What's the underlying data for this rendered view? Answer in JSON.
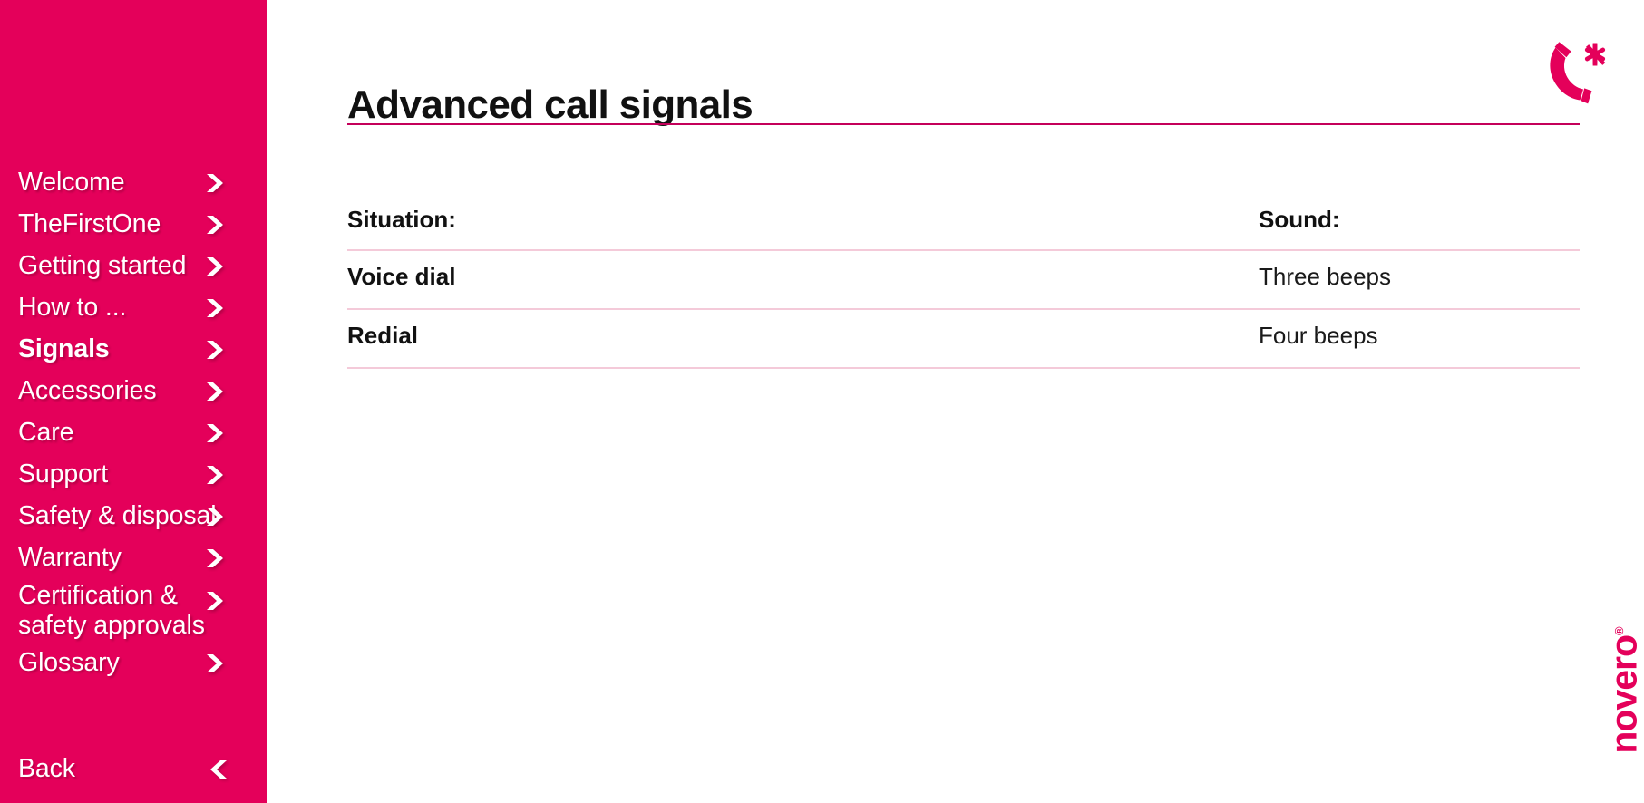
{
  "colors": {
    "brand_pink": "#e4005a",
    "rule_pink": "#c4005a",
    "table_rule_pink": "#f4cad9",
    "sidebar_text": "#ffffff",
    "body_text": "#1a1a1a"
  },
  "sidebar": {
    "items": [
      {
        "label": "Welcome",
        "icon": "chevron-right-icon",
        "active": false
      },
      {
        "label": "TheFirstOne",
        "icon": "chevron-right-icon",
        "active": false
      },
      {
        "label": "Getting started",
        "icon": "chevron-right-icon",
        "active": false
      },
      {
        "label": "How to ...",
        "icon": "chevron-right-icon",
        "active": false
      },
      {
        "label": "Signals",
        "icon": "chevron-right-icon",
        "active": true
      },
      {
        "label": "Accessories",
        "icon": "chevron-right-icon",
        "active": false
      },
      {
        "label": "Care",
        "icon": "chevron-right-icon",
        "active": false
      },
      {
        "label": "Support",
        "icon": "chevron-right-icon",
        "active": false
      },
      {
        "label": "Safety & disposal",
        "icon": "chevron-right-icon",
        "active": false
      },
      {
        "label": "Warranty",
        "icon": "chevron-right-icon",
        "active": false
      },
      {
        "label": "Certification &\nsafety approvals",
        "icon": "chevron-right-icon",
        "active": false
      },
      {
        "label": "Glossary",
        "icon": "chevron-right-icon",
        "active": false
      }
    ],
    "back": {
      "label": "Back",
      "icon": "chevron-left-icon"
    }
  },
  "header": {
    "title": "Advanced call signals",
    "icon": "phone-handset-asterisk-icon"
  },
  "table": {
    "columns": [
      {
        "key": "situation",
        "label": "Situation:"
      },
      {
        "key": "sound",
        "label": "Sound:"
      }
    ],
    "rows": [
      {
        "situation": "Voice dial",
        "sound": "Three beeps"
      },
      {
        "situation": "Redial",
        "sound": "Four beeps"
      }
    ]
  },
  "brand": {
    "name": "novero",
    "trademark": "®"
  }
}
